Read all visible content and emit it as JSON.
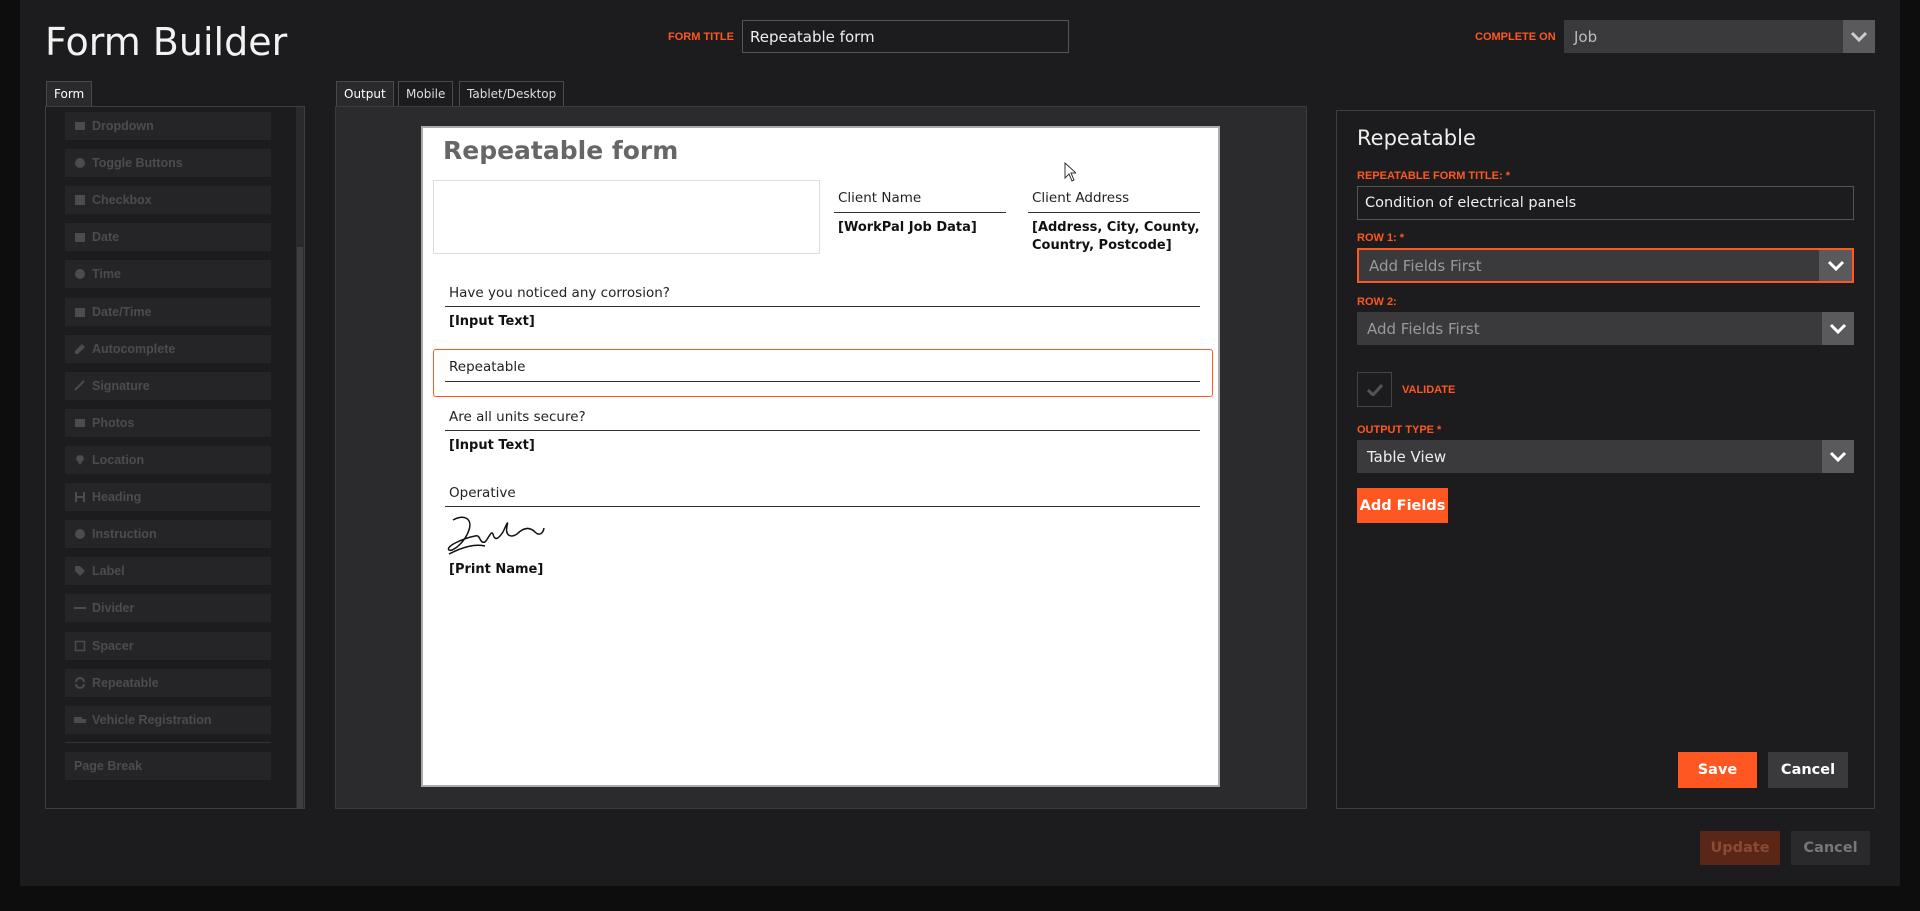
{
  "app": {
    "title": "Form Builder"
  },
  "header": {
    "form_title_label": "FORM TITLE",
    "form_title_value": "Repeatable form",
    "complete_on_label": "COMPLETE ON",
    "complete_on_value": "Job"
  },
  "left_tabs": [
    {
      "label": "Form"
    }
  ],
  "tools": [
    {
      "label": "Dropdown",
      "icon": "dropdown-icon"
    },
    {
      "label": "Toggle Buttons",
      "icon": "toggle-icon"
    },
    {
      "label": "Checkbox",
      "icon": "checkbox-icon"
    },
    {
      "label": "Date",
      "icon": "calendar-icon"
    },
    {
      "label": "Time",
      "icon": "clock-icon"
    },
    {
      "label": "Date/Time",
      "icon": "calendar-clock-icon"
    },
    {
      "label": "Autocomplete",
      "icon": "edit-icon"
    },
    {
      "label": "Signature",
      "icon": "signature-icon"
    },
    {
      "label": "Photos",
      "icon": "image-icon"
    },
    {
      "label": "Location",
      "icon": "map-pin-icon"
    },
    {
      "label": "Heading",
      "icon": "heading-icon"
    },
    {
      "label": "Instruction",
      "icon": "info-icon"
    },
    {
      "label": "Label",
      "icon": "tag-icon"
    },
    {
      "label": "Divider",
      "icon": "divider-icon"
    },
    {
      "label": "Spacer",
      "icon": "square-icon"
    },
    {
      "label": "Repeatable",
      "icon": "repeat-icon"
    },
    {
      "label": "Vehicle Registration",
      "icon": "truck-icon"
    },
    {
      "label": "Page Break",
      "icon": ""
    }
  ],
  "preview_tabs": [
    {
      "label": "Output"
    },
    {
      "label": "Mobile"
    },
    {
      "label": "Tablet/Desktop"
    }
  ],
  "preview": {
    "title": "Repeatable form",
    "client_name_label": "Client Name",
    "client_name_value": "[WorkPal Job Data]",
    "client_address_label": "Client Address",
    "client_address_value_1": "[Address, City, County,",
    "client_address_value_2": "Country, Postcode]",
    "q1_label": "Have you noticed any corrosion?",
    "q1_value": "[Input Text]",
    "repeatable_label": "Repeatable",
    "q2_label": "Are all units secure?",
    "q2_value": "[Input Text]",
    "operative_label": "Operative",
    "operative_value": "[Print Name]"
  },
  "settings": {
    "heading": "Repeatable",
    "repeatable_title_label": "REPEATABLE FORM TITLE: *",
    "repeatable_title_value": "Condition of electrical panels",
    "row1_label": "ROW 1: *",
    "row1_value": "Add Fields First",
    "row2_label": "ROW 2:",
    "row2_value": "Add Fields First",
    "validate_label": "VALIDATE",
    "output_type_label": "OUTPUT TYPE *",
    "output_type_value": "Table View",
    "add_fields_button": "Add Fields",
    "save_button": "Save",
    "cancel_button": "Cancel"
  },
  "footer": {
    "update_button": "Update",
    "cancel_button": "Cancel"
  },
  "colors": {
    "accent": "#ff5722",
    "background": "#1c1c1e"
  }
}
